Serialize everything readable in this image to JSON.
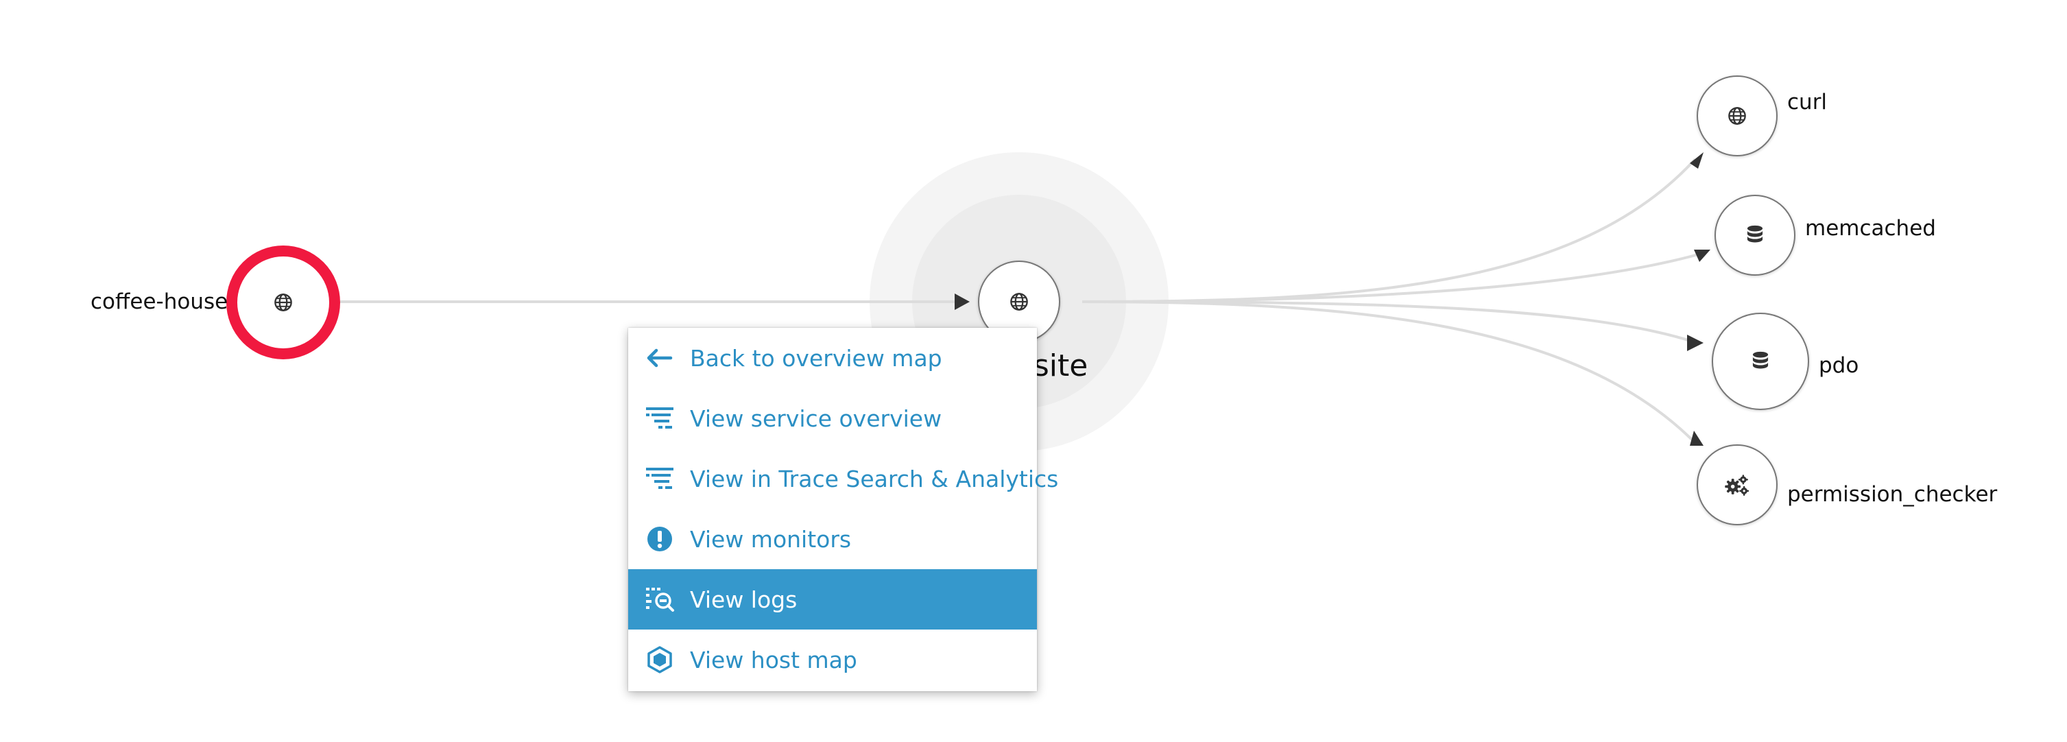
{
  "colors": {
    "error_ring": "#f0193f",
    "edge": "#dcdcdc",
    "arrow": "#333333",
    "menu_text": "#2b8fc4",
    "menu_active_bg": "#3598cc"
  },
  "nodes": {
    "coffee_house": {
      "label": "coffee-house",
      "icon": "globe-icon",
      "status": "error"
    },
    "center": {
      "label_visible": "end.site",
      "icon": "globe-icon"
    },
    "curl": {
      "label": "curl",
      "icon": "globe-icon"
    },
    "memcached": {
      "label": "memcached",
      "icon": "database-icon"
    },
    "pdo": {
      "label": "pdo",
      "icon": "database-icon"
    },
    "permission_checker": {
      "label": "permission_checker",
      "icon": "gears-icon"
    }
  },
  "context_menu": {
    "items": [
      {
        "label": "Back to overview map",
        "icon": "arrow-left-icon",
        "active": false
      },
      {
        "label": "View service overview",
        "icon": "filter-lines-icon",
        "active": false
      },
      {
        "label": "View in Trace Search & Analytics",
        "icon": "filter-lines-icon",
        "active": false
      },
      {
        "label": "View monitors",
        "icon": "exclamation-circle-icon",
        "active": false
      },
      {
        "label": "View logs",
        "icon": "logs-search-icon",
        "active": true
      },
      {
        "label": "View host map",
        "icon": "hexagon-icon",
        "active": false
      }
    ]
  }
}
